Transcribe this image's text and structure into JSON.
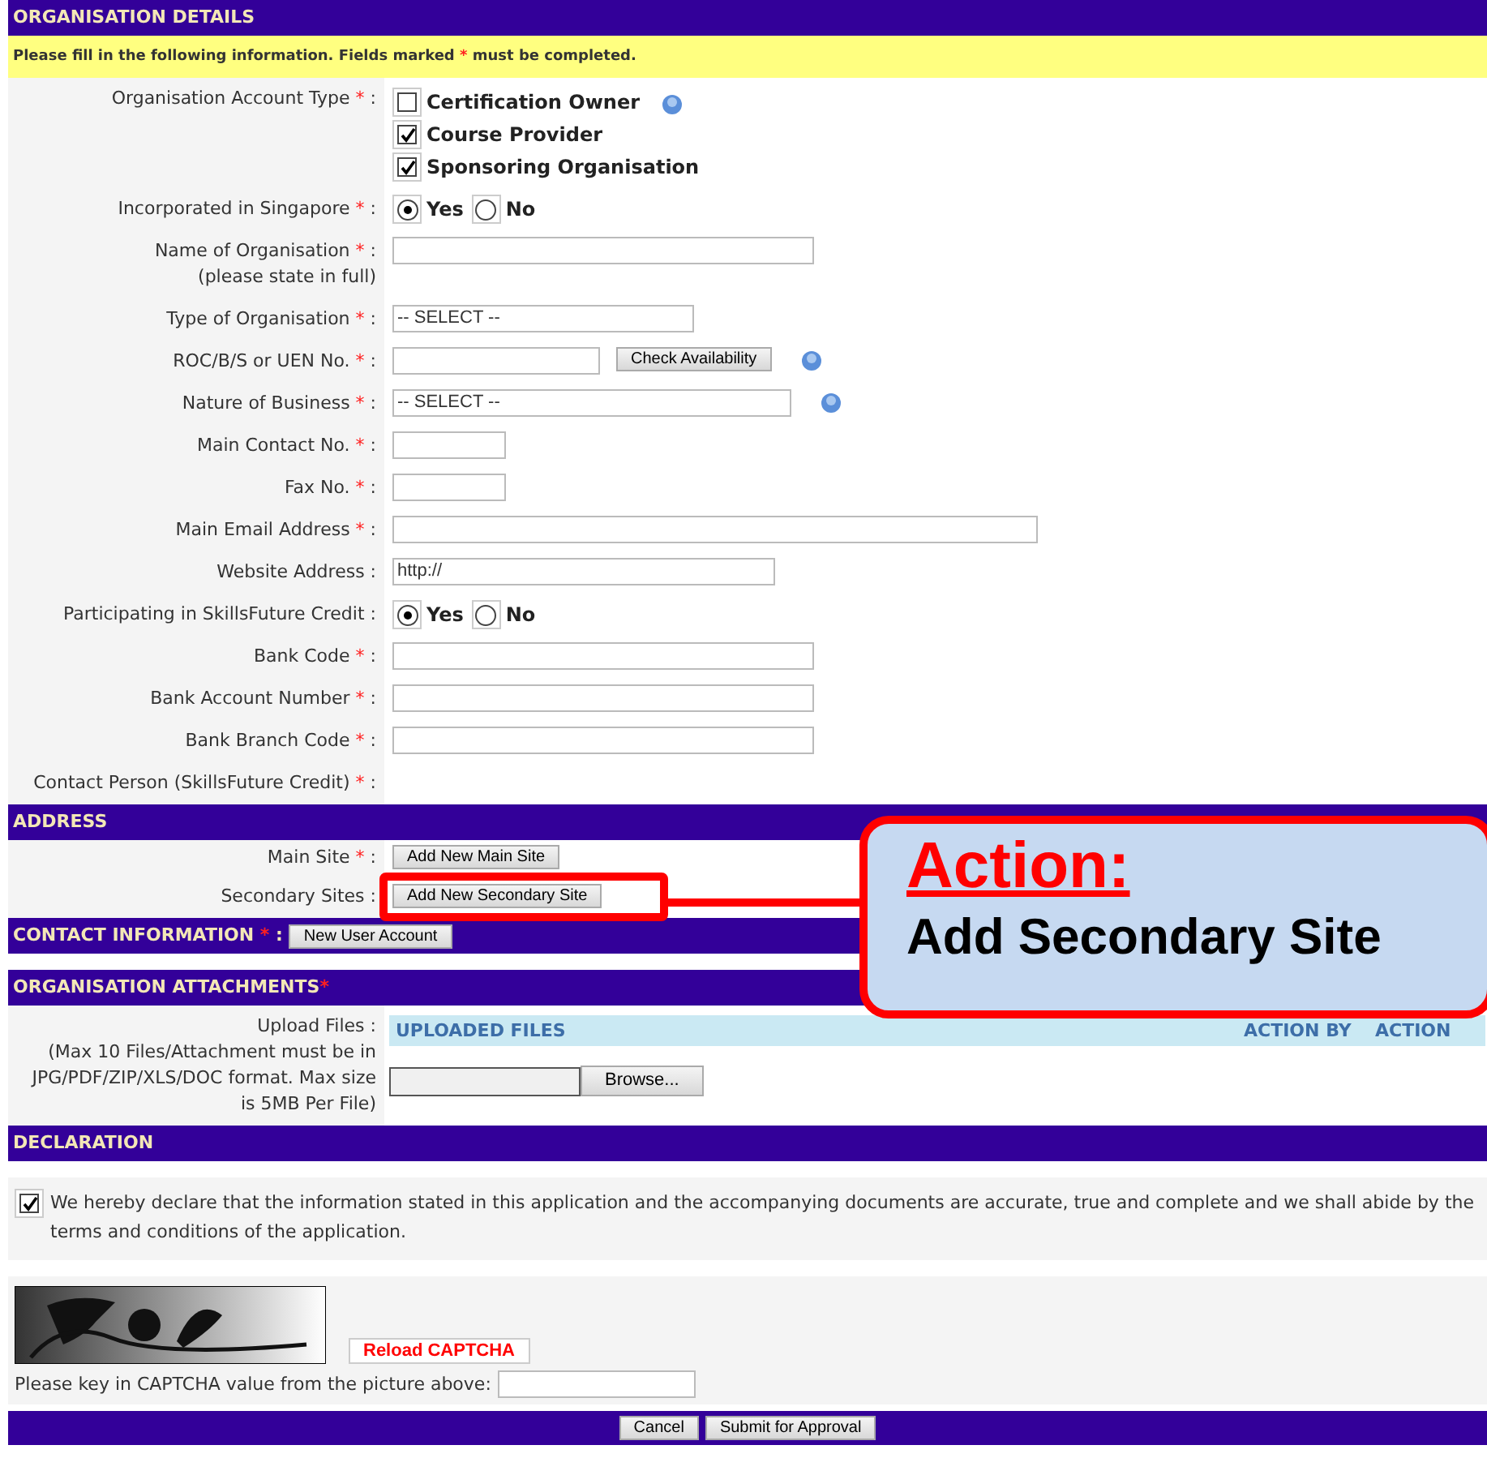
{
  "details": {
    "title": "ORGANISATION DETAILS",
    "notice": {
      "before": "Please fill in the following information. Fields marked",
      "mark": "*",
      "after": "must be completed."
    },
    "fields": [
      {
        "label": "Organisation Account Type",
        "required": true,
        "sep": ":",
        "kind": "checkgroup",
        "options": [
          {
            "label": "Certification Owner",
            "checked": false,
            "help": true
          },
          {
            "label": "Course Provider",
            "checked": true,
            "help": false
          },
          {
            "label": "Sponsoring Organisation",
            "checked": true,
            "help": false
          }
        ]
      },
      {
        "label": "Incorporated in Singapore",
        "required": true,
        "sep": ":",
        "kind": "radio",
        "options": [
          {
            "label": "Yes",
            "selected": true
          },
          {
            "label": "No",
            "selected": false
          }
        ]
      },
      {
        "label": "Name of Organisation",
        "note": "(please state in full)",
        "required": true,
        "sep": ":",
        "kind": "text_long"
      },
      {
        "label": "Type of Organisation",
        "required": true,
        "sep": ":",
        "kind": "select_short",
        "value": "-- SELECT --"
      },
      {
        "label": "ROC/B/S or UEN No.",
        "required": true,
        "sep": ":",
        "kind": "text_short",
        "button": "Check Availability",
        "help": true
      },
      {
        "label": "Nature of Business",
        "required": true,
        "sep": ":",
        "kind": "select_medium",
        "value": "-- SELECT --",
        "help": true
      },
      {
        "label": "Main Contact No.",
        "required": true,
        "sep": ":",
        "kind": "text_tiny"
      },
      {
        "label": "Fax No.",
        "required": true,
        "sep": ":",
        "kind": "text_tiny"
      },
      {
        "label": "Main Email Address",
        "required": true,
        "sep": ":",
        "kind": "text_wide"
      },
      {
        "label": "Website Address",
        "required": false,
        "sep": ":",
        "kind": "text_medium",
        "value": "http://"
      },
      {
        "label": "Participating in SkillsFuture Credit",
        "required": false,
        "sep": ":",
        "kind": "radio",
        "options": [
          {
            "label": "Yes",
            "selected": true
          },
          {
            "label": "No",
            "selected": false
          }
        ]
      },
      {
        "label": "Bank Code",
        "required": true,
        "sep": ":",
        "kind": "text_long"
      },
      {
        "label": "Bank Account Number",
        "required": true,
        "sep": ":",
        "kind": "text_long"
      },
      {
        "label": "Bank Branch Code",
        "required": true,
        "sep": ":",
        "kind": "text_long"
      },
      {
        "label": "Contact Person (SkillsFuture Credit)",
        "required": true,
        "sep": ":",
        "kind": "empty"
      }
    ]
  },
  "address": {
    "title": "ADDRESS",
    "rows": [
      {
        "label": "Main Site",
        "required": true,
        "sep": ":",
        "button": "Add New Main Site",
        "highlighted": false
      },
      {
        "label": "Secondary Sites",
        "required": false,
        "sep": ":",
        "button": "Add New Secondary Site",
        "highlighted": true
      }
    ]
  },
  "contact": {
    "title": "CONTACT INFORMATION",
    "required": true,
    "sep": ":",
    "button": "New User Account"
  },
  "attachments": {
    "title": "ORGANISATION ATTACHMENTS",
    "required": true,
    "label": "Upload Files",
    "sep": ":",
    "note": "(Max 10 Files/Attachment must be in JPG/PDF/ZIP/XLS/DOC format. Max size is 5MB Per File)",
    "columns": [
      "UPLOADED FILES",
      "ACTION BY",
      "ACTION"
    ],
    "browse": "Browse..."
  },
  "declaration": {
    "title": "DECLARATION",
    "checked": true,
    "text": "We hereby declare that the information stated in this application and the accompanying documents are accurate, true and complete and we shall abide by the terms and conditions of the application."
  },
  "captcha": {
    "reload": "Reload CAPTCHA",
    "prompt": "Please key in CAPTCHA value from the picture above:"
  },
  "footer": {
    "buttons": [
      "Cancel",
      "Submit for Approval"
    ]
  },
  "callout": {
    "title": "Action:",
    "text": "Add Secondary Site"
  }
}
